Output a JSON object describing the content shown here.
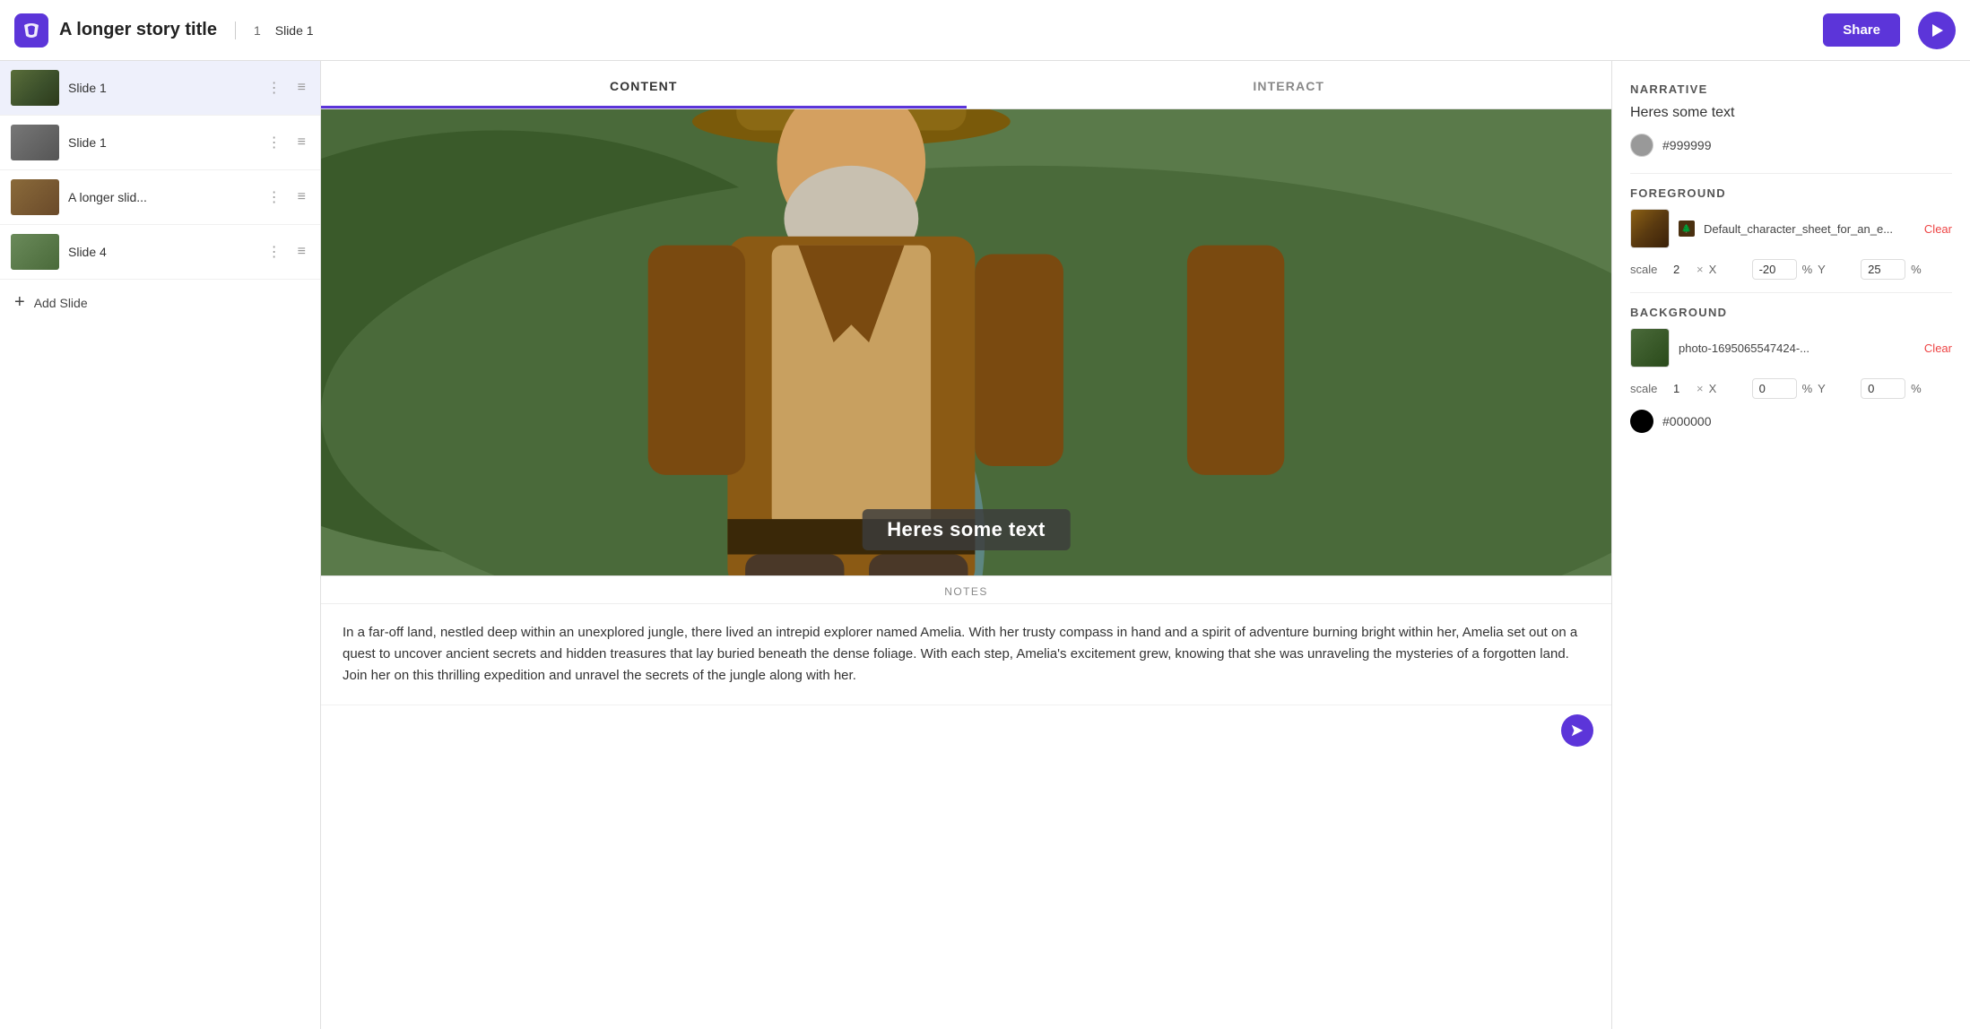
{
  "header": {
    "title": "A longer story title",
    "slide_num": "1",
    "slide_label": "Slide 1",
    "share_label": "Share"
  },
  "sidebar": {
    "slides": [
      {
        "id": "slide-1-active",
        "name": "Slide 1",
        "active": true
      },
      {
        "id": "slide-1-b",
        "name": "Slide 1",
        "active": false
      },
      {
        "id": "slide-longer",
        "name": "A longer slid...",
        "active": false
      },
      {
        "id": "slide-4",
        "name": "Slide 4",
        "active": false
      }
    ],
    "add_slide_label": "Add Slide"
  },
  "tabs": {
    "content_label": "CONTENT",
    "interact_label": "INTERACT"
  },
  "slide_preview": {
    "overlay_text": "Heres some text"
  },
  "notes": {
    "header_label": "NOTES",
    "body_text": "In a far-off land, nestled deep within an unexplored jungle, there lived an intrepid explorer named Amelia. With her trusty compass in hand and a spirit of adventure burning bright within her, Amelia set out on a quest to uncover ancient secrets and hidden treasures that lay buried beneath the dense foliage. With each step, Amelia's excitement grew, knowing that she was unraveling the mysteries of a forgotten land. Join her on this thrilling expedition and unravel the secrets of the jungle along with her."
  },
  "right_panel": {
    "narrative_section_title": "NARRATIVE",
    "narrative_text": "Heres some text",
    "color_value": "#999999",
    "foreground_section_title": "FOREGROUND",
    "foreground_asset_name": "Default_character_sheet_for_an_e...",
    "foreground_clear_label": "Clear",
    "foreground_scale": "2",
    "foreground_x": "-20",
    "foreground_y": "25",
    "background_section_title": "BACKGROUND",
    "background_asset_name": "photo-1695065547424-...",
    "background_clear_label": "Clear",
    "background_scale": "1",
    "background_x": "0",
    "background_y": "0",
    "bg_color_value": "#000000",
    "pct_label": "%",
    "x_label": "X",
    "y_label": "Y",
    "scale_label": "scale",
    "times_label": "×"
  }
}
